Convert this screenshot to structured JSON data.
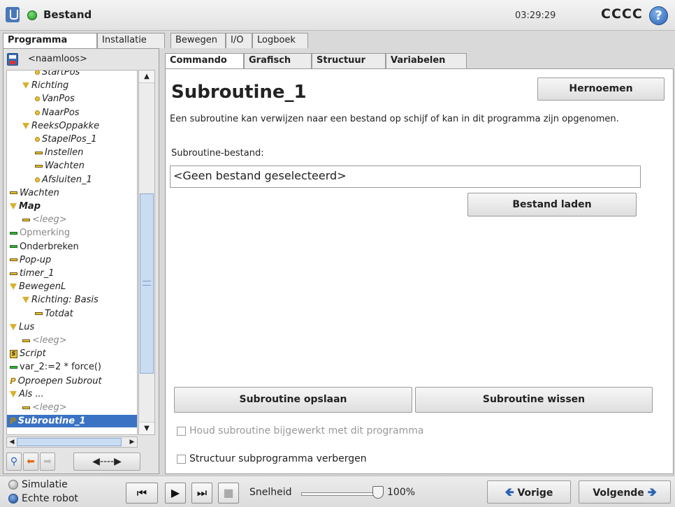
{
  "topbar": {
    "title": "Bestand",
    "time": "03:29:29",
    "robot_name": "CCCC",
    "help": "?"
  },
  "main_tabs": [
    "Programma",
    "Installatie",
    "Bewegen",
    "I/O",
    "Logboek"
  ],
  "program": {
    "name": "<naamloos>"
  },
  "tree": [
    {
      "text": "StartPos",
      "icon": "waypoint-icon",
      "style": "it"
    },
    {
      "text": "Richting",
      "icon": "folder-triangle-icon",
      "style": "it"
    },
    {
      "text": "VanPos",
      "icon": "waypoint-icon",
      "style": "it"
    },
    {
      "text": "NaarPos",
      "icon": "waypoint-icon",
      "style": "it"
    },
    {
      "text": "ReeksOppakke",
      "icon": "folder-triangle-icon",
      "style": "it"
    },
    {
      "text": "StapelPos_1",
      "icon": "waypoint-icon",
      "style": "it"
    },
    {
      "text": "Instellen",
      "icon": "command-icon",
      "style": "it"
    },
    {
      "text": "Wachten",
      "icon": "command-icon",
      "style": "it"
    },
    {
      "text": "Afsluiten_1",
      "icon": "waypoint-icon",
      "style": "it"
    },
    {
      "text": "Wachten",
      "icon": "command-icon",
      "style": "it"
    },
    {
      "text": "Map",
      "icon": "folder-triangle-icon",
      "style": "it bold"
    },
    {
      "text": "<leeg>",
      "icon": "command-icon",
      "style": "it grey"
    },
    {
      "text": "Opmerking",
      "icon": "command-icon",
      "style": "grey"
    },
    {
      "text": "Onderbreken",
      "icon": "command-icon",
      "style": ""
    },
    {
      "text": "Pop-up",
      "icon": "command-icon",
      "style": "it"
    },
    {
      "text": "timer_1",
      "icon": "command-icon",
      "style": "it"
    },
    {
      "text": "BewegenL",
      "icon": "folder-triangle-icon",
      "style": "it"
    },
    {
      "text": "Richting: Basis",
      "icon": "folder-triangle-icon",
      "style": "it"
    },
    {
      "text": "Totdat",
      "icon": "command-icon",
      "style": "it"
    },
    {
      "text": "Lus",
      "icon": "folder-triangle-icon",
      "style": "it"
    },
    {
      "text": "<leeg>",
      "icon": "command-icon",
      "style": "it grey"
    },
    {
      "text": "Script",
      "icon": "script-icon",
      "style": "it"
    },
    {
      "text": "var_2:=2 * force()",
      "icon": "command-icon",
      "style": ""
    },
    {
      "text": "Oproepen Subrout",
      "icon": "call-icon",
      "style": "it"
    },
    {
      "text": "Als ...",
      "icon": "folder-triangle-icon",
      "style": "it"
    },
    {
      "text": "<leeg>",
      "icon": "command-icon",
      "style": "it grey"
    },
    {
      "text": "Subroutine_1",
      "icon": "call-icon",
      "style": "it bold selected"
    }
  ],
  "content_tabs": [
    "Commando",
    "Grafisch",
    "Structuur",
    "Variabelen"
  ],
  "content": {
    "title": "Subroutine_1",
    "rename": "Hernoemen",
    "description": "Een subroutine kan verwijzen naar een bestand op schijf of kan in dit programma zijn opgenomen.",
    "file_label": "Subroutine-bestand:",
    "file_value": "<Geen bestand geselecteerd>",
    "load": "Bestand laden",
    "save": "Subroutine opslaan",
    "clear": "Subroutine wissen",
    "keep_updated": "Houd subroutine bijgewerkt met dit programma",
    "hide_tree": "Structuur subprogramma verbergen"
  },
  "footer": {
    "simulation": "Simulatie",
    "real_robot": "Echte robot",
    "speed_label": "Snelheid",
    "speed_fraction": 1.0,
    "speed_value": "100%",
    "prev": "Vorige",
    "next": "Volgende"
  },
  "colors": {
    "selection": "#3b73c4",
    "accent_blue": "#2b63b3",
    "status_green": "#1e8e1e"
  }
}
